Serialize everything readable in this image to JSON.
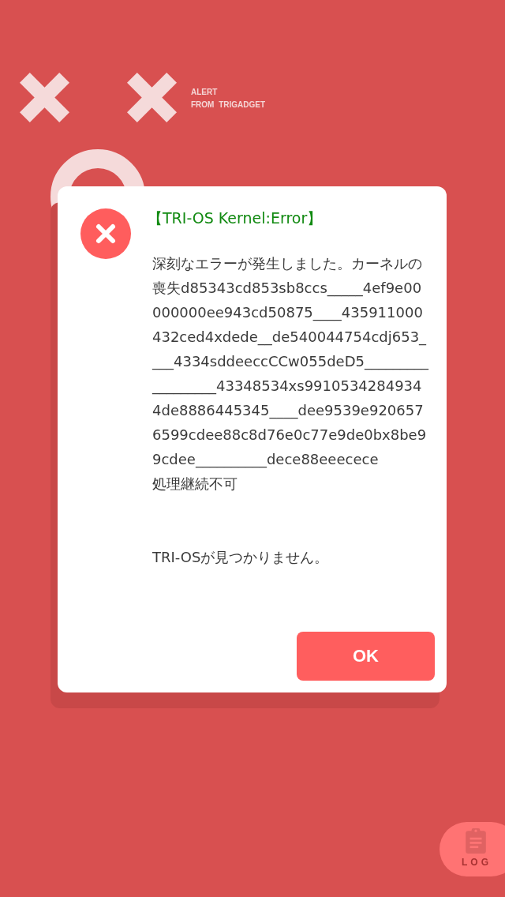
{
  "header": {
    "line_1": "ALERT",
    "line_2": "FROM TRIGADGET"
  },
  "dialog": {
    "title": "【TRI-OS Kernel:Error】",
    "message": "深刻なエラーが発生しました。カーネルの喪失d85343cd853sb8ccs_____4ef9e00000000ee943cd50875____435911000432ced4xdede__de540044754cdj653____4334sddeeccCCw055deD5__________________43348534xs99105342849344de8886445345____dee9539e9206576599cdee88c8d76e0c77e9de0bx8be99cdee__________dece88eeecece",
    "status": "処理継続不可",
    "detail": "TRI-OSが見つかりません。",
    "button": "OK"
  },
  "log_button": {
    "label": "LOG"
  }
}
